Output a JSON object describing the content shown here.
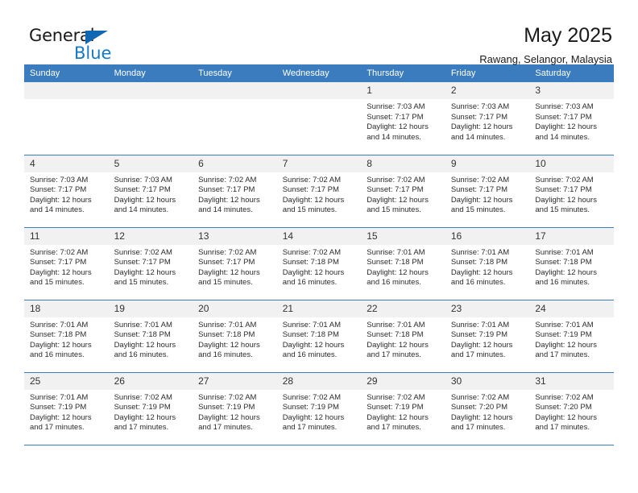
{
  "brand": {
    "name_top": "General",
    "name_bottom": "Blue",
    "accent_color": "#1678c2"
  },
  "header": {
    "title": "May 2025",
    "subtitle": "Rawang, Selangor, Malaysia"
  },
  "calendar": {
    "header_bg": "#3a7cbe",
    "daynum_bg": "#f1f1f1",
    "weekdays": [
      "Sunday",
      "Monday",
      "Tuesday",
      "Wednesday",
      "Thursday",
      "Friday",
      "Saturday"
    ],
    "weeks": [
      [
        {
          "day": "",
          "empty": true
        },
        {
          "day": "",
          "empty": true
        },
        {
          "day": "",
          "empty": true
        },
        {
          "day": "",
          "empty": true
        },
        {
          "day": "1",
          "sunrise": "Sunrise: 7:03 AM",
          "sunset": "Sunset: 7:17 PM",
          "daylight_line1": "Daylight: 12 hours",
          "daylight_line2": "and 14 minutes."
        },
        {
          "day": "2",
          "sunrise": "Sunrise: 7:03 AM",
          "sunset": "Sunset: 7:17 PM",
          "daylight_line1": "Daylight: 12 hours",
          "daylight_line2": "and 14 minutes."
        },
        {
          "day": "3",
          "sunrise": "Sunrise: 7:03 AM",
          "sunset": "Sunset: 7:17 PM",
          "daylight_line1": "Daylight: 12 hours",
          "daylight_line2": "and 14 minutes."
        }
      ],
      [
        {
          "day": "4",
          "sunrise": "Sunrise: 7:03 AM",
          "sunset": "Sunset: 7:17 PM",
          "daylight_line1": "Daylight: 12 hours",
          "daylight_line2": "and 14 minutes."
        },
        {
          "day": "5",
          "sunrise": "Sunrise: 7:03 AM",
          "sunset": "Sunset: 7:17 PM",
          "daylight_line1": "Daylight: 12 hours",
          "daylight_line2": "and 14 minutes."
        },
        {
          "day": "6",
          "sunrise": "Sunrise: 7:02 AM",
          "sunset": "Sunset: 7:17 PM",
          "daylight_line1": "Daylight: 12 hours",
          "daylight_line2": "and 14 minutes."
        },
        {
          "day": "7",
          "sunrise": "Sunrise: 7:02 AM",
          "sunset": "Sunset: 7:17 PM",
          "daylight_line1": "Daylight: 12 hours",
          "daylight_line2": "and 15 minutes."
        },
        {
          "day": "8",
          "sunrise": "Sunrise: 7:02 AM",
          "sunset": "Sunset: 7:17 PM",
          "daylight_line1": "Daylight: 12 hours",
          "daylight_line2": "and 15 minutes."
        },
        {
          "day": "9",
          "sunrise": "Sunrise: 7:02 AM",
          "sunset": "Sunset: 7:17 PM",
          "daylight_line1": "Daylight: 12 hours",
          "daylight_line2": "and 15 minutes."
        },
        {
          "day": "10",
          "sunrise": "Sunrise: 7:02 AM",
          "sunset": "Sunset: 7:17 PM",
          "daylight_line1": "Daylight: 12 hours",
          "daylight_line2": "and 15 minutes."
        }
      ],
      [
        {
          "day": "11",
          "sunrise": "Sunrise: 7:02 AM",
          "sunset": "Sunset: 7:17 PM",
          "daylight_line1": "Daylight: 12 hours",
          "daylight_line2": "and 15 minutes."
        },
        {
          "day": "12",
          "sunrise": "Sunrise: 7:02 AM",
          "sunset": "Sunset: 7:17 PM",
          "daylight_line1": "Daylight: 12 hours",
          "daylight_line2": "and 15 minutes."
        },
        {
          "day": "13",
          "sunrise": "Sunrise: 7:02 AM",
          "sunset": "Sunset: 7:17 PM",
          "daylight_line1": "Daylight: 12 hours",
          "daylight_line2": "and 15 minutes."
        },
        {
          "day": "14",
          "sunrise": "Sunrise: 7:02 AM",
          "sunset": "Sunset: 7:18 PM",
          "daylight_line1": "Daylight: 12 hours",
          "daylight_line2": "and 16 minutes."
        },
        {
          "day": "15",
          "sunrise": "Sunrise: 7:01 AM",
          "sunset": "Sunset: 7:18 PM",
          "daylight_line1": "Daylight: 12 hours",
          "daylight_line2": "and 16 minutes."
        },
        {
          "day": "16",
          "sunrise": "Sunrise: 7:01 AM",
          "sunset": "Sunset: 7:18 PM",
          "daylight_line1": "Daylight: 12 hours",
          "daylight_line2": "and 16 minutes."
        },
        {
          "day": "17",
          "sunrise": "Sunrise: 7:01 AM",
          "sunset": "Sunset: 7:18 PM",
          "daylight_line1": "Daylight: 12 hours",
          "daylight_line2": "and 16 minutes."
        }
      ],
      [
        {
          "day": "18",
          "sunrise": "Sunrise: 7:01 AM",
          "sunset": "Sunset: 7:18 PM",
          "daylight_line1": "Daylight: 12 hours",
          "daylight_line2": "and 16 minutes."
        },
        {
          "day": "19",
          "sunrise": "Sunrise: 7:01 AM",
          "sunset": "Sunset: 7:18 PM",
          "daylight_line1": "Daylight: 12 hours",
          "daylight_line2": "and 16 minutes."
        },
        {
          "day": "20",
          "sunrise": "Sunrise: 7:01 AM",
          "sunset": "Sunset: 7:18 PM",
          "daylight_line1": "Daylight: 12 hours",
          "daylight_line2": "and 16 minutes."
        },
        {
          "day": "21",
          "sunrise": "Sunrise: 7:01 AM",
          "sunset": "Sunset: 7:18 PM",
          "daylight_line1": "Daylight: 12 hours",
          "daylight_line2": "and 16 minutes."
        },
        {
          "day": "22",
          "sunrise": "Sunrise: 7:01 AM",
          "sunset": "Sunset: 7:18 PM",
          "daylight_line1": "Daylight: 12 hours",
          "daylight_line2": "and 17 minutes."
        },
        {
          "day": "23",
          "sunrise": "Sunrise: 7:01 AM",
          "sunset": "Sunset: 7:19 PM",
          "daylight_line1": "Daylight: 12 hours",
          "daylight_line2": "and 17 minutes."
        },
        {
          "day": "24",
          "sunrise": "Sunrise: 7:01 AM",
          "sunset": "Sunset: 7:19 PM",
          "daylight_line1": "Daylight: 12 hours",
          "daylight_line2": "and 17 minutes."
        }
      ],
      [
        {
          "day": "25",
          "sunrise": "Sunrise: 7:01 AM",
          "sunset": "Sunset: 7:19 PM",
          "daylight_line1": "Daylight: 12 hours",
          "daylight_line2": "and 17 minutes."
        },
        {
          "day": "26",
          "sunrise": "Sunrise: 7:02 AM",
          "sunset": "Sunset: 7:19 PM",
          "daylight_line1": "Daylight: 12 hours",
          "daylight_line2": "and 17 minutes."
        },
        {
          "day": "27",
          "sunrise": "Sunrise: 7:02 AM",
          "sunset": "Sunset: 7:19 PM",
          "daylight_line1": "Daylight: 12 hours",
          "daylight_line2": "and 17 minutes."
        },
        {
          "day": "28",
          "sunrise": "Sunrise: 7:02 AM",
          "sunset": "Sunset: 7:19 PM",
          "daylight_line1": "Daylight: 12 hours",
          "daylight_line2": "and 17 minutes."
        },
        {
          "day": "29",
          "sunrise": "Sunrise: 7:02 AM",
          "sunset": "Sunset: 7:19 PM",
          "daylight_line1": "Daylight: 12 hours",
          "daylight_line2": "and 17 minutes."
        },
        {
          "day": "30",
          "sunrise": "Sunrise: 7:02 AM",
          "sunset": "Sunset: 7:20 PM",
          "daylight_line1": "Daylight: 12 hours",
          "daylight_line2": "and 17 minutes."
        },
        {
          "day": "31",
          "sunrise": "Sunrise: 7:02 AM",
          "sunset": "Sunset: 7:20 PM",
          "daylight_line1": "Daylight: 12 hours",
          "daylight_line2": "and 17 minutes."
        }
      ]
    ]
  }
}
